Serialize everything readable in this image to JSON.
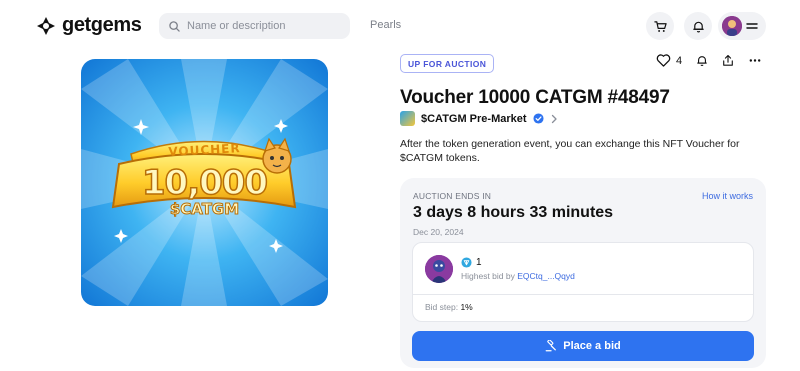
{
  "header": {
    "logo_text": "getgems",
    "search_placeholder": "Name or description",
    "nav_pearls": "Pearls"
  },
  "nft": {
    "image_icon": "voucher-artwork",
    "image_text_top": "VOUCHER",
    "image_text_amount": "10,000",
    "image_text_token": "$CATGM",
    "status_badge": "UP FOR AUCTION",
    "likes": "4",
    "title": "Voucher 10000 CATGM #48497",
    "collection_name": "$CATGM Pre-Market",
    "description": "After the token generation event, you can exchange this NFT Voucher for $CATGM tokens."
  },
  "auction": {
    "ends_label": "AUCTION ENDS IN",
    "how_it_works": "How it works",
    "countdown": "3 days 8 hours 33 minutes",
    "end_date": "Dec 20, 2024",
    "highest_bid_amount": "1",
    "highest_bid_prefix": "Highest bid by ",
    "highest_bidder": "EQCtq_...Qqyd",
    "bid_step_label": "Bid step: ",
    "bid_step_value": "1%",
    "place_bid_label": "Place a bid"
  },
  "colors": {
    "accent": "#2e73f0",
    "badge": "#4a55d8",
    "link": "#3d6be0",
    "card_bg": "#f4f5f8"
  }
}
